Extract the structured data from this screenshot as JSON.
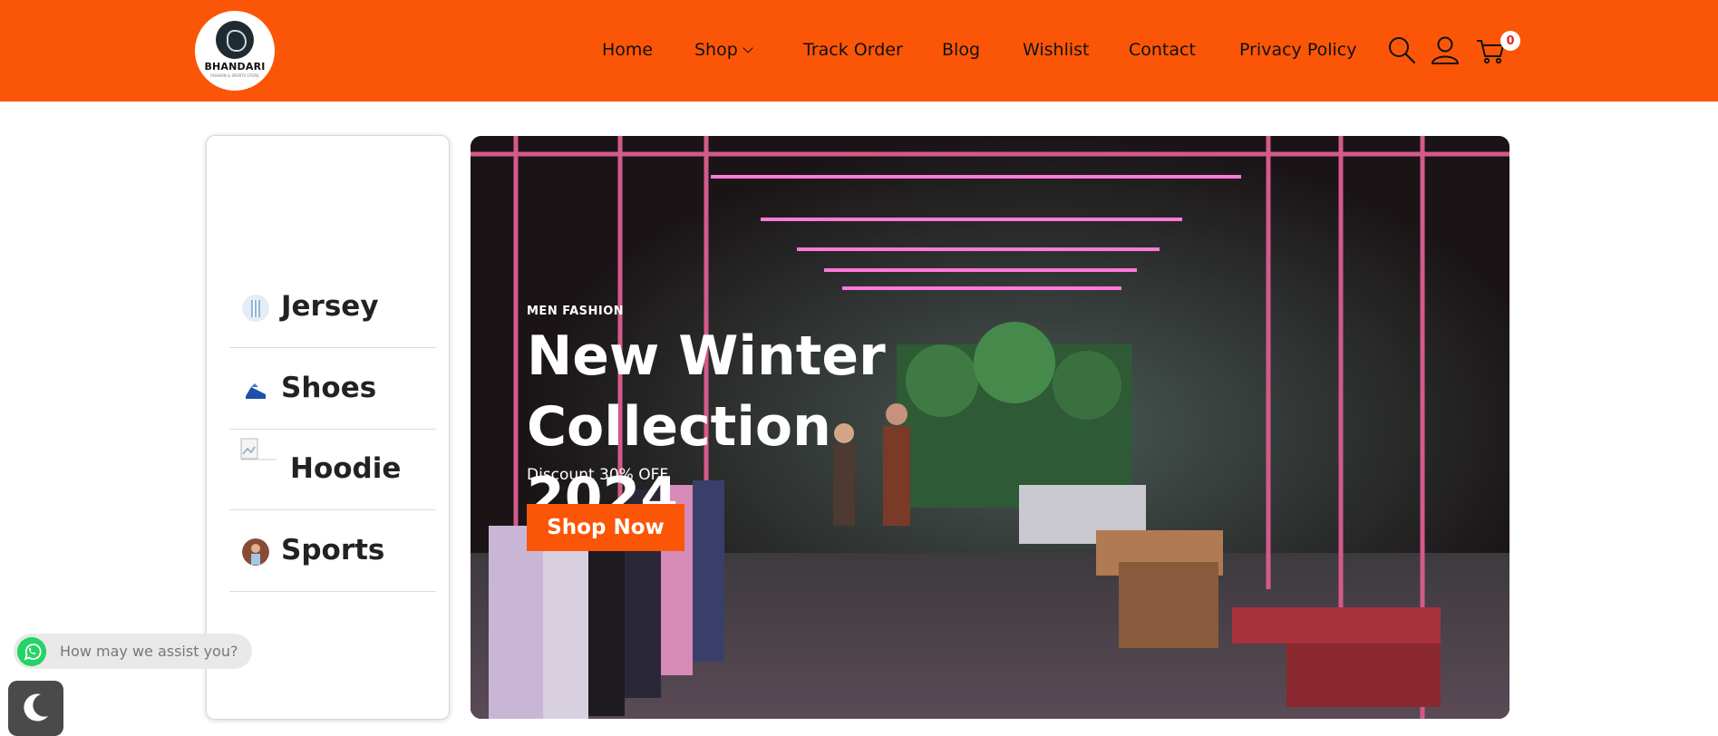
{
  "brand": {
    "logo_text": "BHANDARI",
    "logo_subtext": "FASHION & SPORTS STORE"
  },
  "nav": {
    "items": [
      {
        "label": "Home"
      },
      {
        "label": "Shop"
      },
      {
        "label": "Track Order"
      },
      {
        "label": "Blog"
      },
      {
        "label": "Wishlist"
      },
      {
        "label": "Contact"
      },
      {
        "label": "Privacy Policy"
      }
    ],
    "cart_count": "0",
    "icons": [
      "search-icon",
      "user-icon",
      "cart-icon"
    ]
  },
  "sidebar": {
    "categories": [
      {
        "label": "Jersey",
        "icon": "jersey-thumb"
      },
      {
        "label": "Shoes",
        "icon": "shoe-thumb"
      },
      {
        "label": "Hoodie",
        "icon": "broken-image-thumb"
      },
      {
        "label": "Sports",
        "icon": "sports-thumb"
      }
    ]
  },
  "banner": {
    "eyebrow": "MEN FASHION",
    "headline": "New Winter Collection 2024",
    "discount": "Discount 30% OFF",
    "cta": "Shop Now"
  },
  "chat": {
    "prompt": "How may we assist you?"
  },
  "colors": {
    "brand_orange": "#fb5607",
    "whatsapp_green": "#25d366"
  }
}
